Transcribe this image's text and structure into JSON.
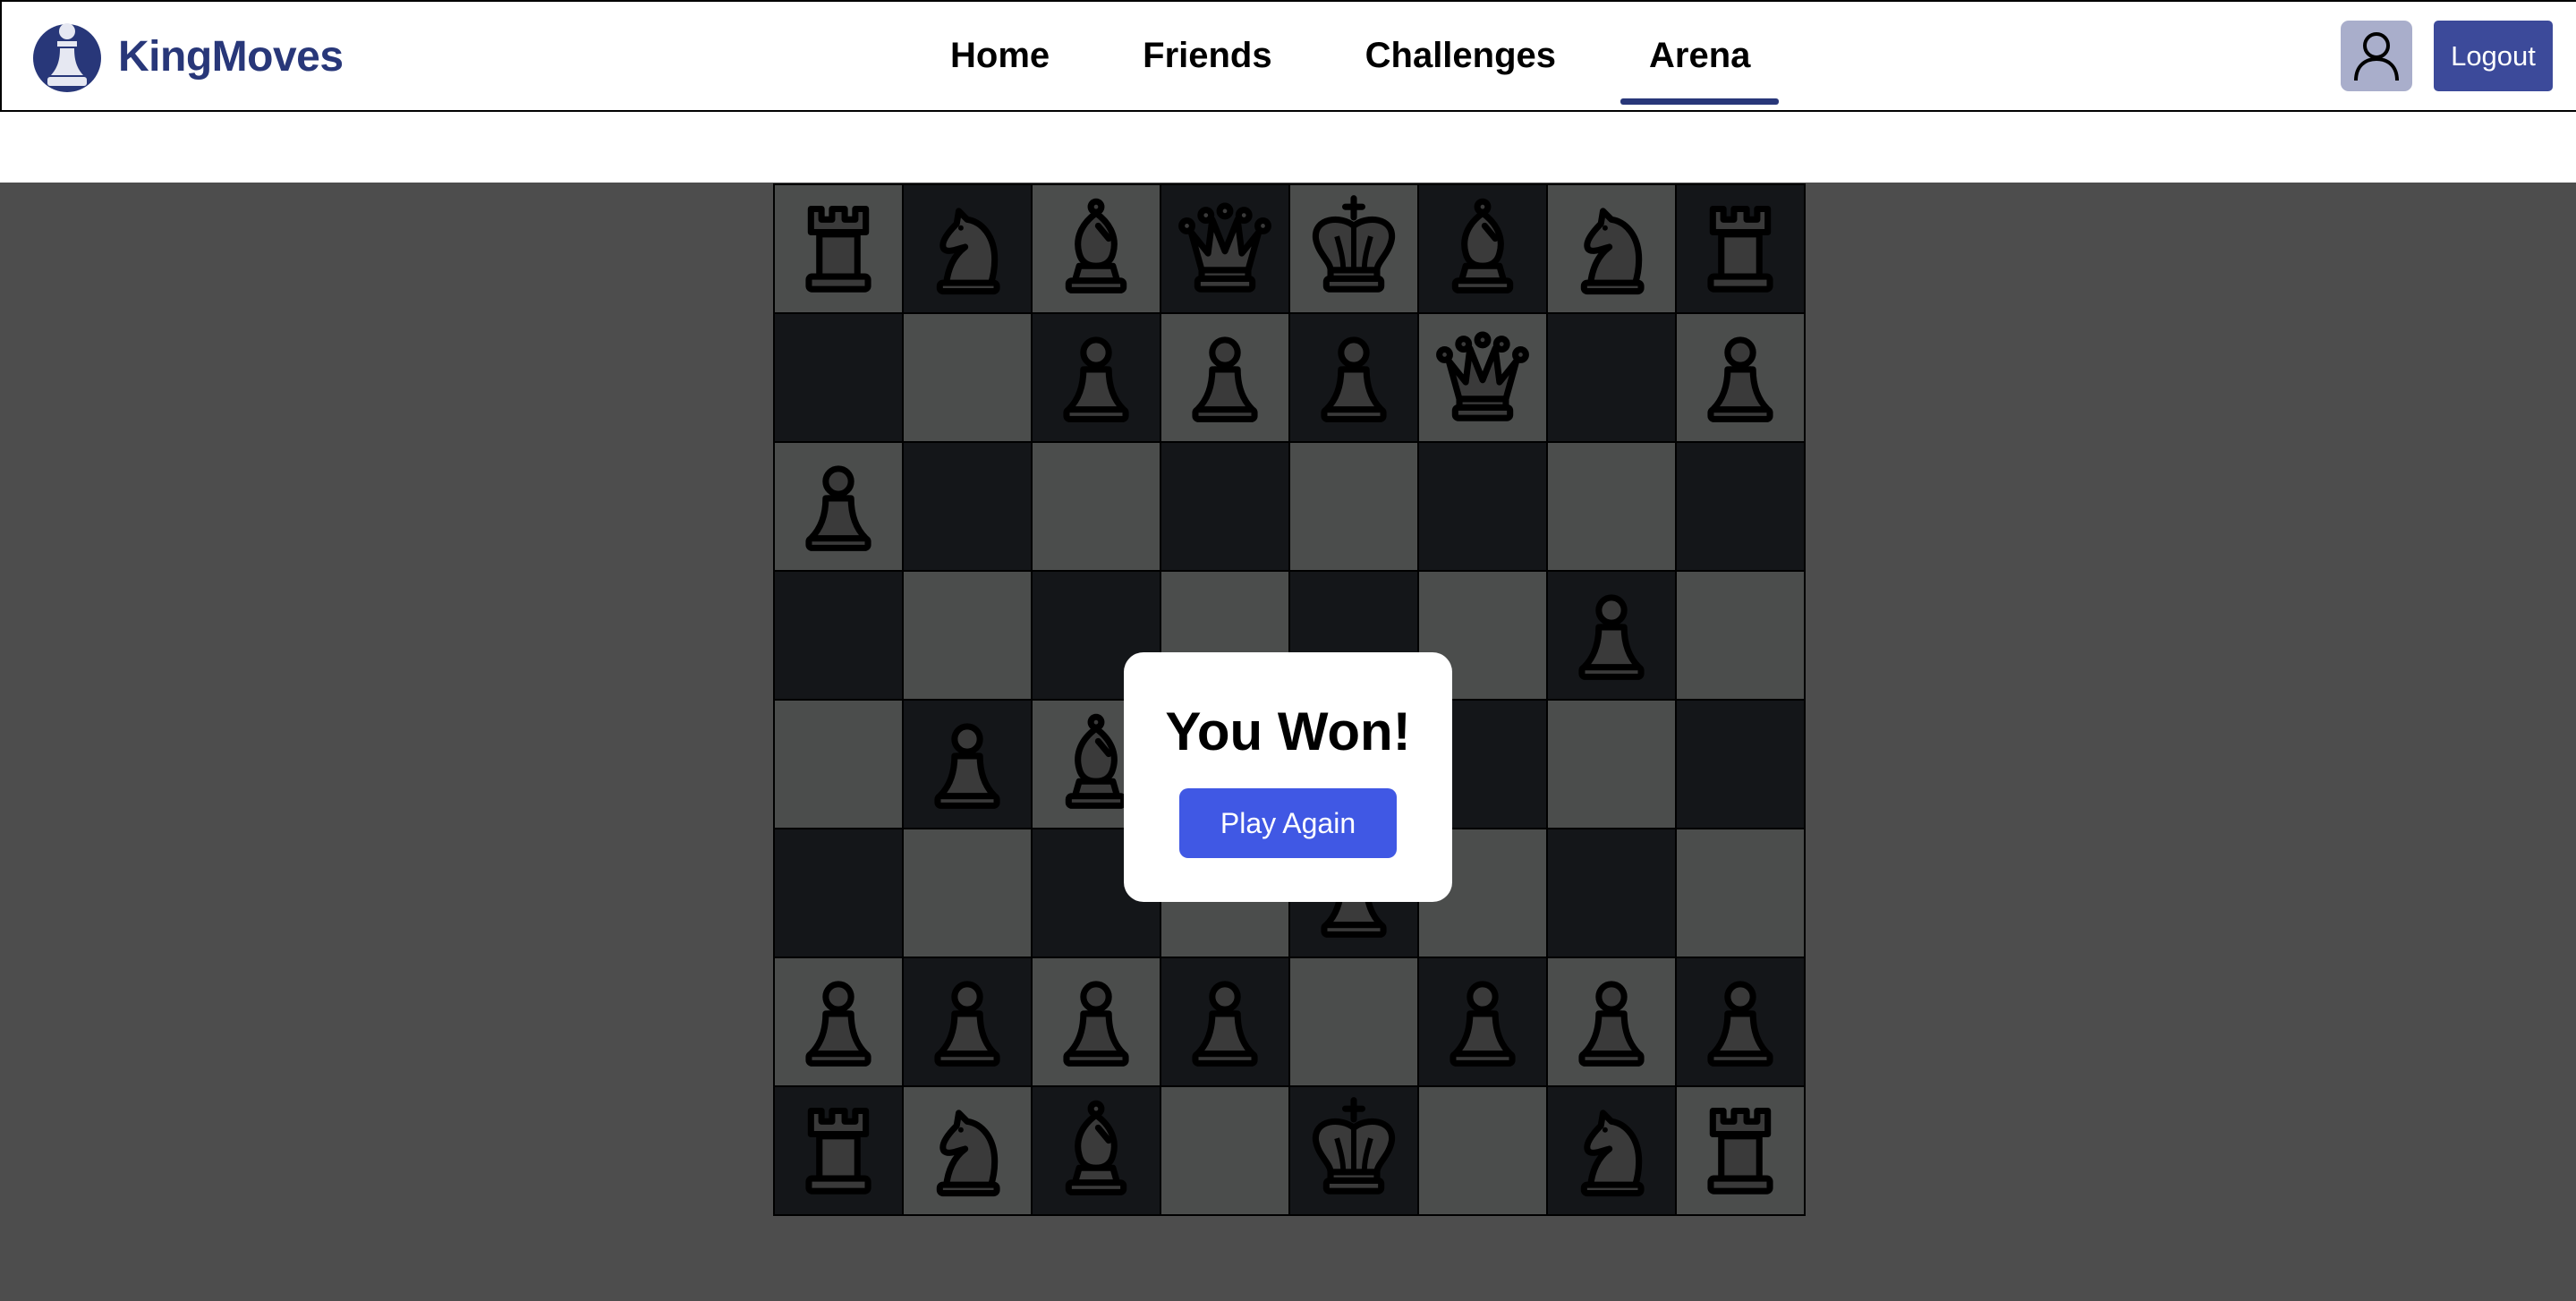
{
  "app": {
    "name": "KingMoves",
    "logo_icon": "pawn-logo-icon"
  },
  "nav": {
    "links": [
      {
        "label": "Home"
      },
      {
        "label": "Friends"
      },
      {
        "label": "Challenges"
      },
      {
        "label": "Arena",
        "active": true
      }
    ]
  },
  "header": {
    "avatar_icon": "user-icon",
    "logout_label": "Logout"
  },
  "colors": {
    "brand": "#283779",
    "logout_bg": "#3c4a9a",
    "play_again_bg": "#4058e4",
    "light_square": "#4b4d4c",
    "dark_square": "#141619"
  },
  "board": {
    "rows": [
      [
        "r",
        "n",
        "b",
        "q",
        "k",
        "b",
        "n",
        "r"
      ],
      [
        "",
        "",
        "p",
        "p",
        "p",
        "q",
        "",
        "p"
      ],
      [
        "p",
        "",
        "",
        "",
        "",
        "",
        "",
        ""
      ],
      [
        "",
        "",
        "",
        "",
        "",
        "",
        "p",
        ""
      ],
      [
        "",
        "p",
        "b",
        "",
        "",
        "",
        "",
        ""
      ],
      [
        "",
        "",
        "",
        "",
        "p",
        "",
        "",
        ""
      ],
      [
        "p",
        "p",
        "p",
        "p",
        "",
        "p",
        "p",
        "p"
      ],
      [
        "r",
        "n",
        "b",
        "",
        "k",
        "",
        "n",
        "r"
      ]
    ]
  },
  "result": {
    "title": "You Won!",
    "button_label": "Play Again"
  }
}
